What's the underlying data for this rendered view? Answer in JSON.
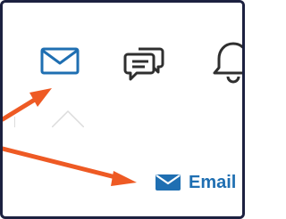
{
  "toolbar": {
    "icons": [
      "mail-icon",
      "chat-icon",
      "bell-icon"
    ]
  },
  "email_link": {
    "label": "Email",
    "icon": "envelope-icon"
  },
  "colors": {
    "accent_blue": "#1f6fb2",
    "annotation_orange": "#ee5a24",
    "frame_border": "#1c2140",
    "icon_gray": "#2f2f2f"
  }
}
